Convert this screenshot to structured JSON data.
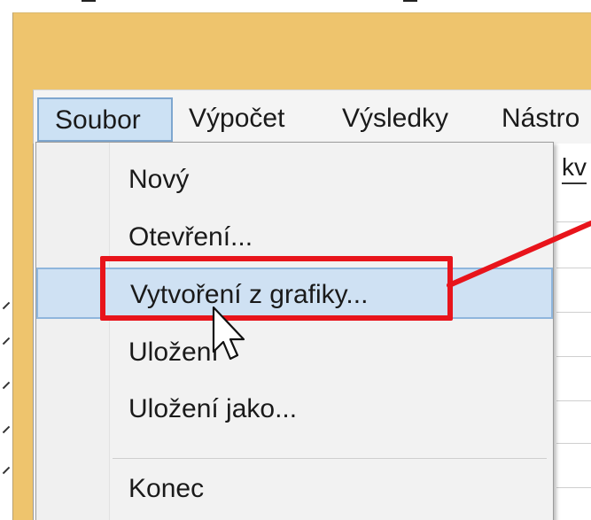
{
  "menubar": {
    "items": [
      {
        "label": "Soubor",
        "active": true
      },
      {
        "label": "Výpočet",
        "active": false
      },
      {
        "label": "Výsledky",
        "active": false
      },
      {
        "label": "Nástro",
        "active": false
      }
    ]
  },
  "dropdown": {
    "items": [
      {
        "label": "Nový",
        "highlighted": false
      },
      {
        "label": "Otevření...",
        "highlighted": false
      },
      {
        "label": "Vytvoření z grafiky...",
        "highlighted": true
      },
      {
        "label": "Uložení",
        "highlighted": false
      },
      {
        "label": "Uložení jako...",
        "highlighted": false
      },
      {
        "label": "Konec",
        "highlighted": false
      }
    ]
  },
  "background_grid": {
    "header_text": "kv"
  },
  "annotation": {
    "color": "#e8141b",
    "target": "Vytvoření z grafiky..."
  },
  "colors": {
    "window_title": "#eec46d",
    "menu_highlight": "#cce1f4",
    "item_highlight": "#cfe1f3"
  },
  "icons": {
    "cursor": "mouse-pointer-arrow-icon"
  }
}
